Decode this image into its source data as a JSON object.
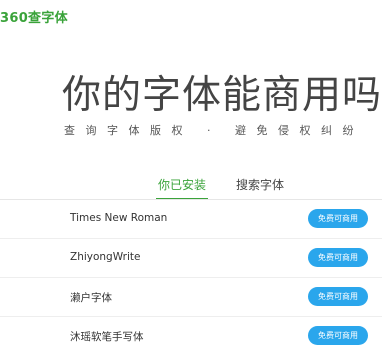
{
  "logo": {
    "text": "360查字体"
  },
  "hero": {
    "title": "你的字体能商用吗？",
    "subtitle": "查询字体版权 · 避免侵权纠纷"
  },
  "tabs": [
    {
      "label": "你已安装",
      "active": true
    },
    {
      "label": "搜索字体",
      "active": false
    }
  ],
  "fonts": [
    {
      "name": "Times New Roman",
      "button": "免费可商用"
    },
    {
      "name": "ZhiyongWrite",
      "button": "免费可商用"
    },
    {
      "name": "濑户字体",
      "button": "免费可商用"
    },
    {
      "name": "沐瑶软笔手写体",
      "button": "免费可商用"
    }
  ],
  "colors": {
    "brand_green": "#3aa33a",
    "button_blue": "#2aa6ec",
    "title_gray": "#444444"
  }
}
